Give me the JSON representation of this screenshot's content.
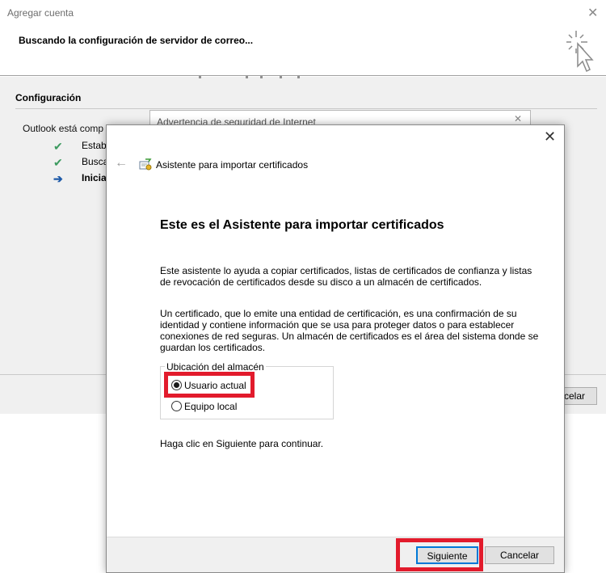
{
  "background_window": {
    "title": "Agregar cuenta",
    "heading": "Buscando la configuración de servidor de correo...",
    "section_title": "Configuración",
    "status_text": "Outlook está comp",
    "steps": [
      {
        "mark": "✔",
        "label": "Estab"
      },
      {
        "mark": "✔",
        "label": "Busca"
      },
      {
        "mark": "➔",
        "label": "Inician"
      }
    ],
    "cancel_label": "celar",
    "warning_title": "Advertencia de seguridad de Internet"
  },
  "wizard": {
    "title": "Asistente para importar certificados",
    "heading": "Este es el Asistente para importar certificados",
    "intro": "Este asistente lo ayuda a copiar certificados, listas de certificados de confianza y listas de revocación de certificados desde su disco a un almacén de certificados.",
    "description": "Un certificado, que lo emite una entidad de certificación, es una confirmación de su identidad y contiene información que se usa para proteger datos o para establecer conexiones de red seguras. Un almacén de certificados es el área del sistema donde se guardan los certificados.",
    "store_location": {
      "legend": "Ubicación del almacén",
      "options": [
        {
          "label": "Usuario actual",
          "selected": true
        },
        {
          "label": "Equipo local",
          "selected": false
        }
      ]
    },
    "continue_hint": "Haga clic en Siguiente para continuar.",
    "next_label": "Siguiente",
    "cancel_label": "Cancelar"
  },
  "colors": {
    "highlight": "#e21b2c",
    "accent": "#0078d7",
    "check": "#3c9a5f",
    "arrow": "#1e5aa8"
  }
}
